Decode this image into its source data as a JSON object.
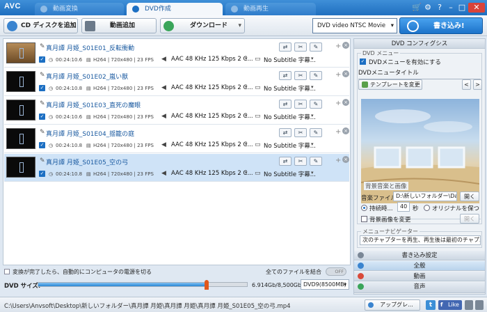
{
  "app": {
    "logo": "AVC"
  },
  "tabs": [
    {
      "label": "動画変換",
      "active": false
    },
    {
      "label": "DVD作成",
      "active": true
    },
    {
      "label": "動画再生",
      "active": false
    }
  ],
  "window_controls": {
    "cart": "🛒",
    "settings": "⚙",
    "help": "?",
    "minimize": "–",
    "maximize": "□",
    "close": "✕"
  },
  "toolbar": {
    "add_cd": "CD ディスクを追加",
    "add_video": "動画追加",
    "download": "ダウンロード",
    "arrow": "▾",
    "profile": "DVD video NTSC Movie",
    "burn": "書き込み!"
  },
  "files": [
    {
      "title": "真月譚 月姫_S01E01_反転衝動",
      "duration": "00:24:10.6",
      "video": "H264 | 720x480 | 23 FPS",
      "audio": "AAC 48 KHz 125 Kbps 2 C...",
      "subtitle": "No Subtitle 字幕...",
      "selected": false,
      "warm": true
    },
    {
      "title": "真月譚 月姫_S01E02_嵐い獣",
      "duration": "00:24:10.8",
      "video": "H264 | 720x480 | 23 FPS",
      "audio": "AAC 48 KHz 125 Kbps 2 C...",
      "subtitle": "No Subtitle 字幕...",
      "selected": false,
      "warm": false
    },
    {
      "title": "真月譚 月姫_S01E03_直死の魔眼",
      "duration": "00:24:10.6",
      "video": "H264 | 720x480 | 23 FPS",
      "audio": "AAC 48 KHz 125 Kbps 2 C...",
      "subtitle": "No Subtitle 字幕...",
      "selected": false,
      "warm": false
    },
    {
      "title": "真月譚 月姫_S01E04_揺籠の庭",
      "duration": "00:24:10.8",
      "video": "H264 | 720x480 | 23 FPS",
      "audio": "AAC 48 KHz 125 Kbps 2 C...",
      "subtitle": "No Subtitle 字幕...",
      "selected": false,
      "warm": false
    },
    {
      "title": "真月譚 月姫_S01E05_空の弓",
      "duration": "00:24:10.8",
      "video": "H264 | 720x480 | 23 FPS",
      "audio": "AAC 48 KHz 125 Kbps 2 C...",
      "subtitle": "No Subtitle 字幕...",
      "selected": true,
      "warm": false
    }
  ],
  "row_buttons": {
    "swap": "⇄",
    "cut": "✂",
    "effect": "✎",
    "plus": "+",
    "remove": "×"
  },
  "options": {
    "shutdown_label": "変換が完了したら、自動的にコンピュータの電源を切る",
    "merge_label": "全てのファイルを結合",
    "toggle": "OFF"
  },
  "dvd_size": {
    "label": "DVD サイズ:",
    "usage": "6.914Gb/8,500Gb",
    "disc": "DVD9(8500MB)",
    "fill_fraction": 0.81
  },
  "status": {
    "path": "C:\\Users\\Anvsoft\\Desktop\\新しいフォルダー\\真月譚 月姫\\真月譚 月姫\\真月譚 月姫_S01E05_空の弓.mp4",
    "upgrade": "アップグレ...",
    "like": "Like"
  },
  "panel": {
    "title": "DVD コンフィグシス",
    "menu_group": "DVD メニュー",
    "enable_menu": "DVDメニューを有効にする",
    "menu_title_label": "DVDメニュータイトル",
    "change_template": "テンプレートを変更",
    "prev": "<",
    "next": ">",
    "bgm_group": "背景音楽と画像",
    "music_file_label": "音楽ファイル",
    "music_path": "D:\\新しいフォルダー\\Datz",
    "open": "開く",
    "duration_label": "持続時...",
    "duration_value": "40",
    "seconds": "秒",
    "keep_original": "オリジナルを保つ",
    "change_bg": "背景画像を変更",
    "open2": "開く",
    "nav_group": "メニューナビゲーター",
    "nav_value": "次のチャプターを再生、再生後は最初のチャプ...",
    "burn_settings": "書き込み設定",
    "general": "全般",
    "video": "動画",
    "audio": "音声"
  },
  "colors": {
    "accent": "#1c6fc3",
    "burn": "#1b72c9",
    "selected_row": "#cfe3f7",
    "close": "#d9433a"
  }
}
